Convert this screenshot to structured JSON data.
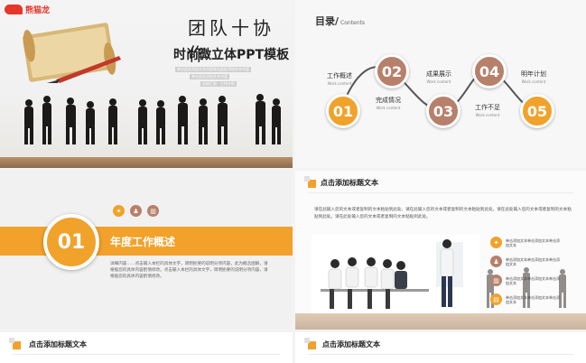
{
  "logo": {
    "text": "熊猫龙"
  },
  "cover": {
    "handwritten_title": "团队十协作",
    "main_title": "时尚微立体PPT模板",
    "caption_lines": [
      "单击此处添加文本内容单击此处添加文本内容",
      "单击此处添加文本内容",
      "总结汇报 · 工作计划"
    ]
  },
  "toc": {
    "title": "目录/",
    "title_en": "Contents",
    "items": [
      {
        "num": "01",
        "label": "工作概述",
        "sub": "Work content",
        "color": "#f0a22b"
      },
      {
        "num": "02",
        "label": "完成情况",
        "sub": "Work content",
        "color": "#b7806b"
      },
      {
        "num": "03",
        "label": "成果展示",
        "sub": "Work content",
        "color": "#b7806b"
      },
      {
        "num": "04",
        "label": "工作不足",
        "sub": "Work content",
        "color": "#b7806b"
      },
      {
        "num": "05",
        "label": "明年计划",
        "sub": "Work content",
        "color": "#f0a22b"
      }
    ]
  },
  "section": {
    "number": "01",
    "title": "年度工作概述",
    "icons": [
      "bulb-icon",
      "people-icon",
      "chart-icon"
    ],
    "body": "详细内容……点击输入本栏的具体文字，简明扼要的说明分项内容，此为概念图解，请根据您的具体内容酌情修改。点击输入本栏的具体文字，简明扼要的说明分项内容，请根据您的具体内容酌情修改。"
  },
  "slide4": {
    "header": "点击添加标题文本",
    "paragraph": "请在此输入您的文本或者复制的文本粘贴到此处。请在此输入您的文本或者复制的文本粘贴到此处。请在此处输入您的文本或者复制的文本粘贴到此处。请在此处输入您的文本或者复制的文本粘贴到此处。",
    "bullets": [
      {
        "icon": "bulb-icon",
        "text": "单击添加文本单击添加文本单击添加文本"
      },
      {
        "icon": "people-icon",
        "text": "单击添加文本单击添加文本单击添加文本"
      },
      {
        "icon": "chart-icon",
        "text": "单击添加文本单击添加文本单击添加文本"
      },
      {
        "icon": "doc-icon",
        "text": "单击添加文本单击添加文本单击添加文本"
      }
    ]
  },
  "slide5": {
    "header": "点击添加标题文本"
  },
  "slide6": {
    "header": "点击添加标题文本"
  },
  "colors": {
    "accent": "#f0a22b",
    "accent_dark": "#b7806b",
    "brand_red": "#e8352a"
  }
}
